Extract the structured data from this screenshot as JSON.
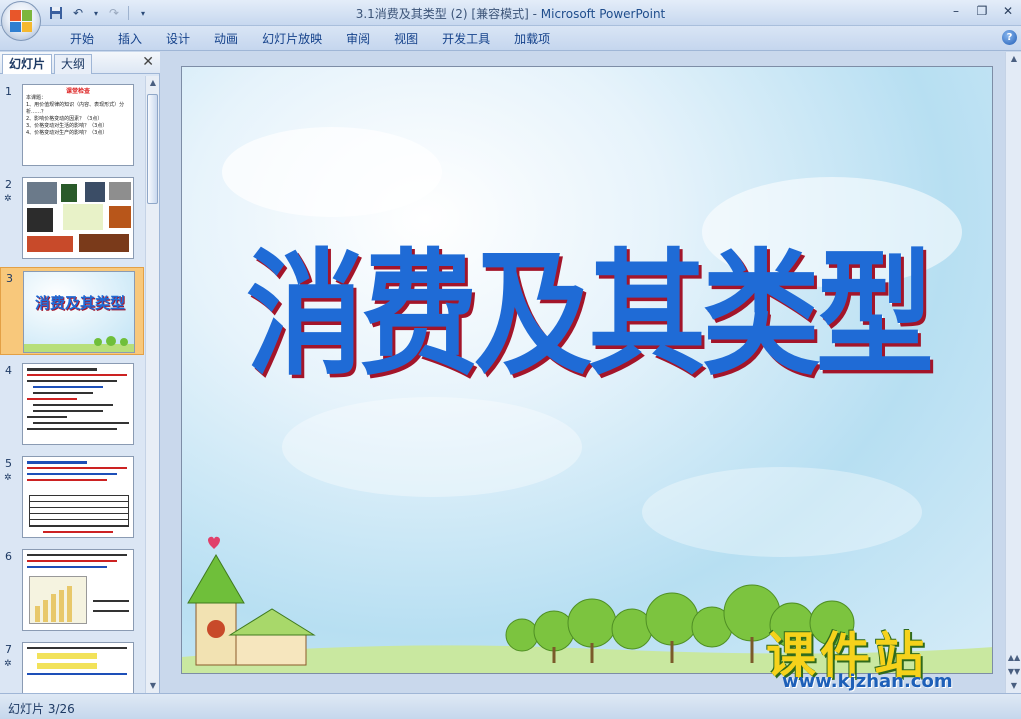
{
  "window": {
    "title": "3.1消费及其类型 (2) [兼容模式]",
    "title_sep": " - ",
    "app_name": "Microsoft PowerPoint"
  },
  "quick_access": {
    "save_icon": "save-icon",
    "undo_icon": "undo-icon",
    "redo_icon": "redo-icon"
  },
  "ribbon": {
    "tabs": [
      "开始",
      "插入",
      "设计",
      "动画",
      "幻灯片放映",
      "审阅",
      "视图",
      "开发工具",
      "加载项"
    ]
  },
  "panel": {
    "tab_slides": "幻灯片",
    "tab_outline": "大纲"
  },
  "thumbnails": [
    {
      "num": "1",
      "star": "",
      "title": "课堂检查",
      "lines": [
        "本课题：",
        "1、用价值规律的知识（内容、表现形式）分析……？",
        "2、影响价格变动的因素？（3点）",
        "3、价格变动对生活的影响？（3点）",
        "4、价格变动对生产的影响？（3点）"
      ]
    },
    {
      "num": "2",
      "star": "✲"
    },
    {
      "num": "3",
      "star": "",
      "title": "消费及其类型"
    },
    {
      "num": "4",
      "star": ""
    },
    {
      "num": "5",
      "star": "✲"
    },
    {
      "num": "6",
      "star": ""
    },
    {
      "num": "7",
      "star": "✲"
    }
  ],
  "slide": {
    "title": "消费及其类型"
  },
  "watermark": {
    "brand": "课件站",
    "url": "www.kjzhan.com"
  },
  "status": {
    "slide_info": "幻灯片 3/26"
  },
  "colors": {
    "title_blue": "#1f6bd6",
    "title_shadow": "#a3152a",
    "selected_thumb": "#f8c87b"
  }
}
